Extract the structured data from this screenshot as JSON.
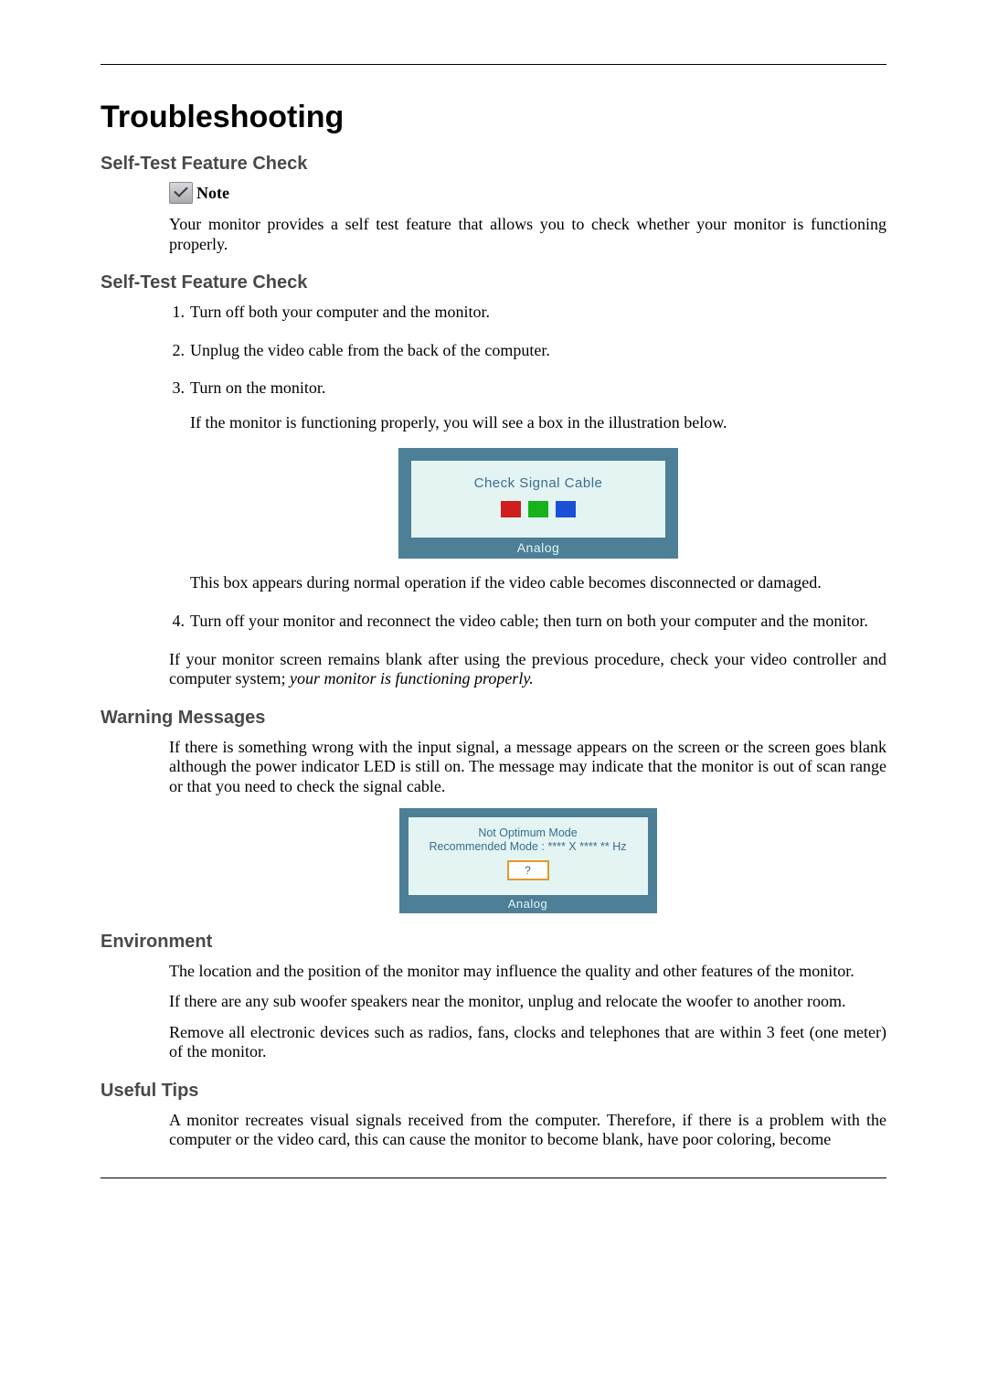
{
  "title": "Troubleshooting",
  "sections": {
    "selftest1": {
      "heading": "Self-Test Feature Check",
      "note_label": "Note",
      "intro": "Your monitor provides a self test feature that allows you to check whether your monitor is functioning properly."
    },
    "selftest2": {
      "heading": "Self-Test Feature Check",
      "steps": {
        "s1": "Turn off both your computer and the monitor.",
        "s2": "Unplug the video cable from the back of the computer.",
        "s3": "Turn on the monitor.",
        "s3_sub": "If the monitor is functioning properly, you will see a box in the illustration below.",
        "s3_after": "This box appears during normal operation if the video cable becomes disconnected or damaged.",
        "s4": "Turn off your monitor and reconnect the video cable; then turn on both your computer and the monitor."
      },
      "closing_plain": "If your monitor screen remains blank after using the previous procedure, check your video controller and computer system; ",
      "closing_italic": "your monitor is functioning properly."
    },
    "warning": {
      "heading": "Warning Messages",
      "intro": "If there is something wrong with the input signal, a message appears on the screen or the screen goes blank although the power indicator LED is still on. The message may indicate that the monitor is out of scan range or that you need to check the signal cable."
    },
    "environment": {
      "heading": "Environment",
      "p1": "The location and the position of the monitor may influence the quality and other features of the monitor.",
      "p2": "If there are any sub woofer speakers near the monitor, unplug and relocate the woofer to another room.",
      "p3": "Remove all electronic devices such as radios, fans, clocks and telephones that are within 3 feet (one meter) of the monitor."
    },
    "tips": {
      "heading": "Useful Tips",
      "p1": "A monitor recreates visual signals received from the computer. Therefore, if there is a problem with the computer or the video card, this can cause the monitor to become blank, have poor coloring, become"
    }
  },
  "diagrams": {
    "check_cable": {
      "title": "Check Signal Cable",
      "footer": "Analog"
    },
    "not_optimum": {
      "line1": "Not Optimum Mode",
      "line2": "Recommended Mode : **** X **** ** Hz",
      "button": "?",
      "footer": "Analog"
    }
  }
}
